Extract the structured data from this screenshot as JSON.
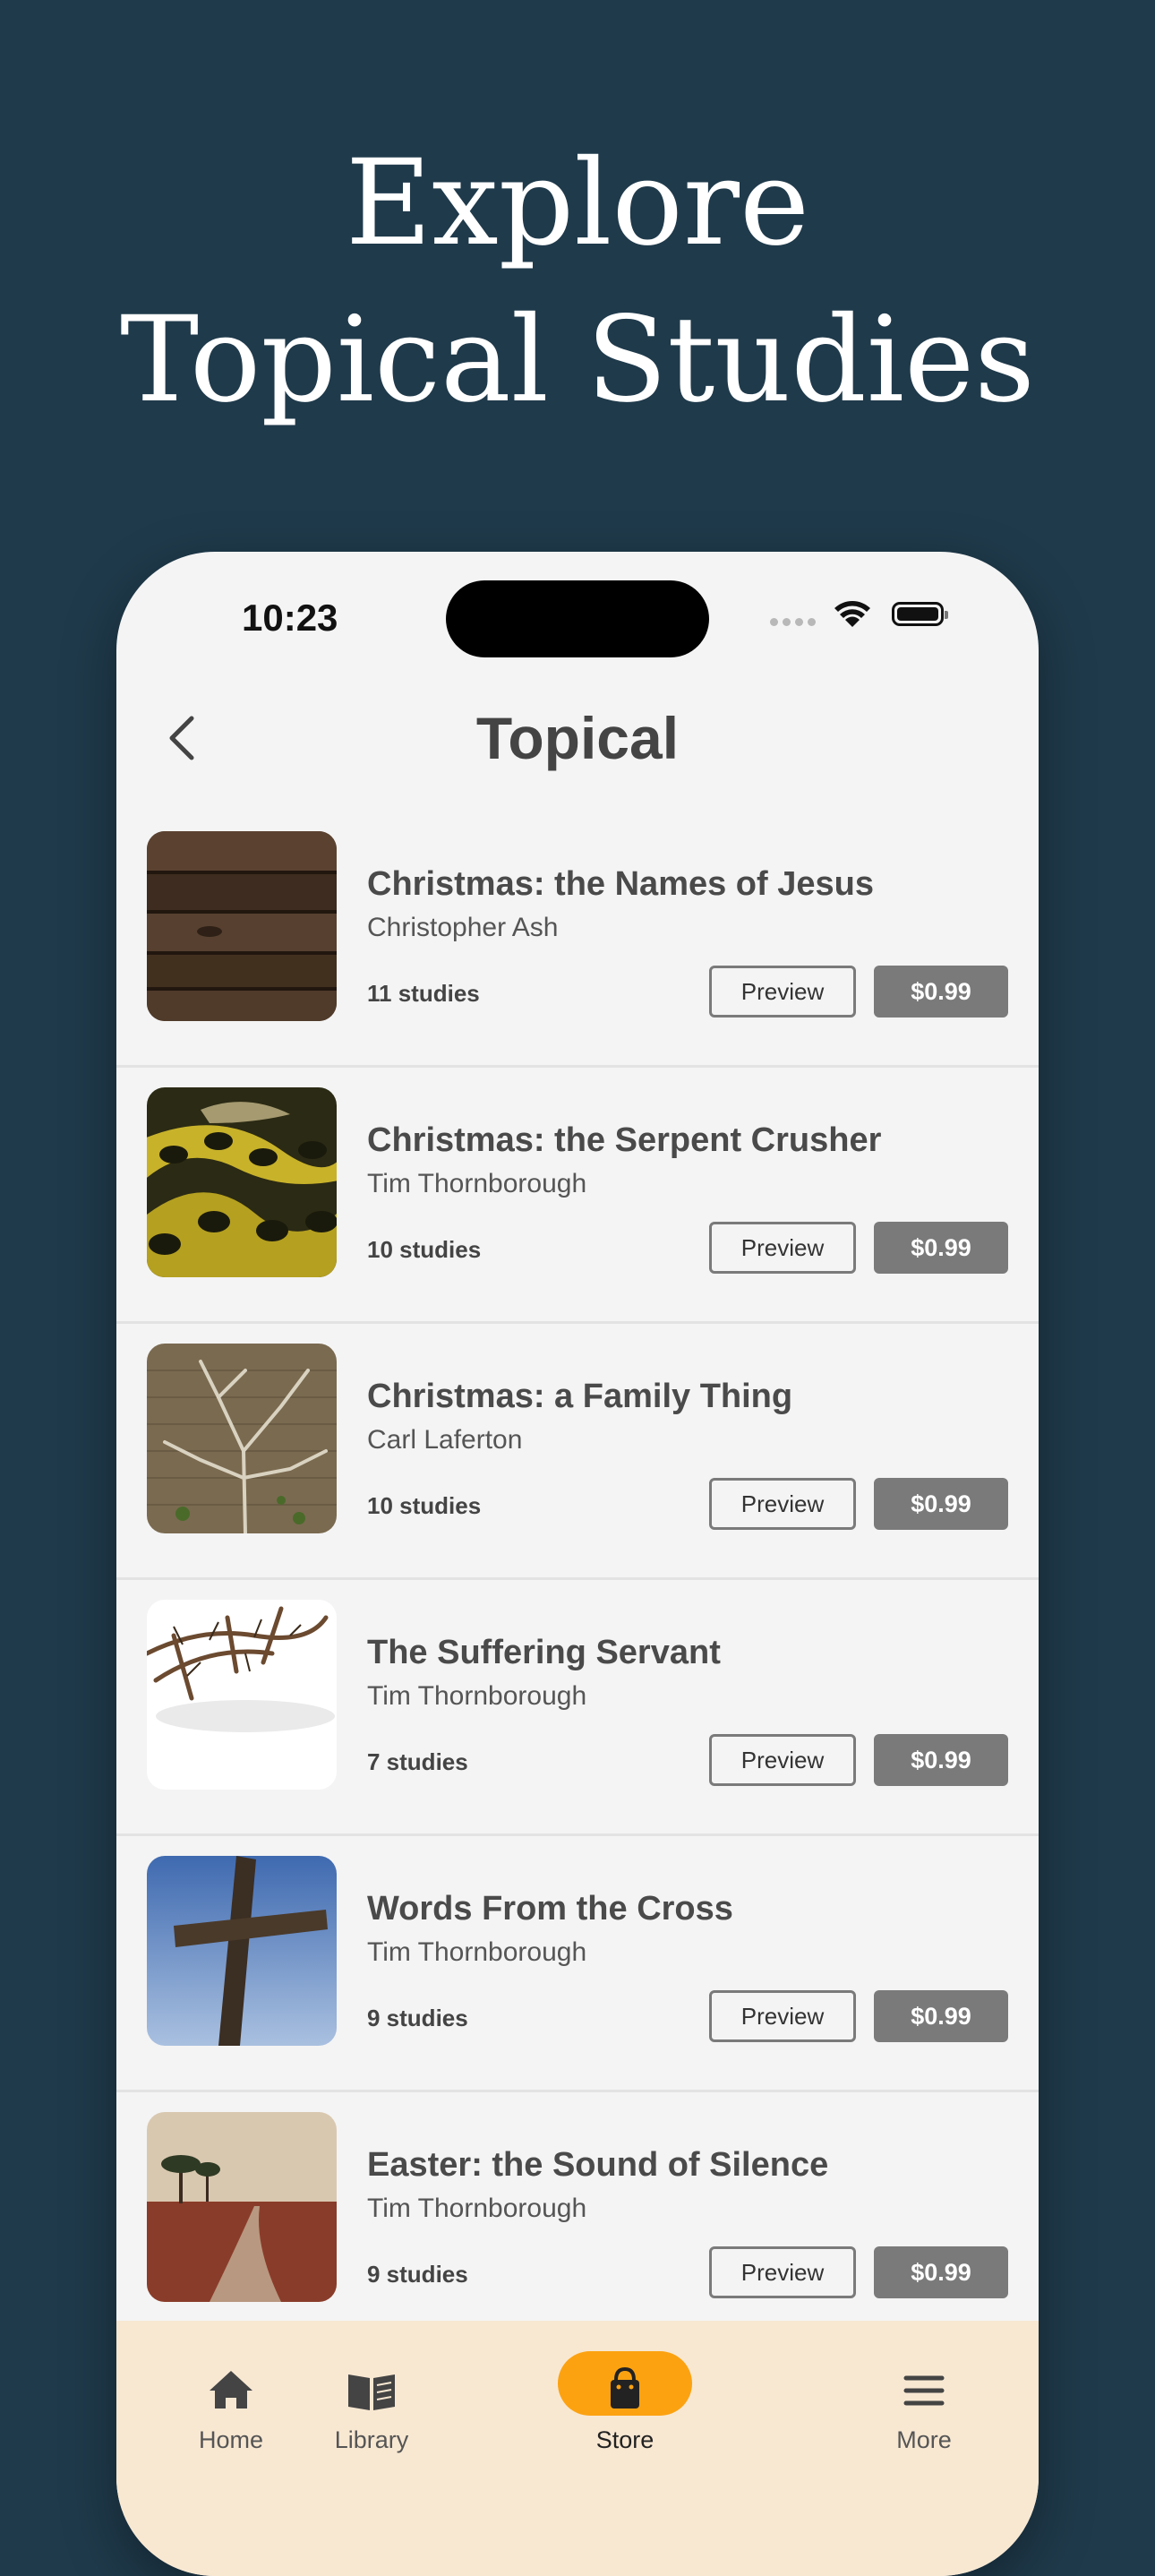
{
  "headline": {
    "line1": "Explore",
    "line2": "Topical Studies"
  },
  "status_bar": {
    "time": "10:23"
  },
  "nav": {
    "title": "Topical"
  },
  "items": [
    {
      "title": "Christmas: the Names of Jesus",
      "author": "Christopher Ash",
      "count": "11 studies",
      "preview": "Preview",
      "price": "$0.99",
      "image": "wooden-planks"
    },
    {
      "title": "Christmas: the Serpent Crusher",
      "author": "Tim Thornborough",
      "count": "10 studies",
      "preview": "Preview",
      "price": "$0.99",
      "image": "snake"
    },
    {
      "title": "Christmas: a Family Thing",
      "author": "Carl Laferton",
      "count": "10 studies",
      "preview": "Preview",
      "price": "$0.99",
      "image": "vine-on-wall"
    },
    {
      "title": "The Suffering Servant",
      "author": "Tim Thornborough",
      "count": "7 studies",
      "preview": "Preview",
      "price": "$0.99",
      "image": "crown-of-thorns"
    },
    {
      "title": "Words From the Cross",
      "author": "Tim Thornborough",
      "count": "9 studies",
      "preview": "Preview",
      "price": "$0.99",
      "image": "wooden-cross"
    },
    {
      "title": "Easter: the Sound of Silence",
      "author": "Tim Thornborough",
      "count": "9 studies",
      "preview": "Preview",
      "price": "$0.99",
      "image": "desert-path"
    }
  ],
  "tabbar": {
    "tabs": [
      {
        "label": "Home",
        "icon": "home-icon"
      },
      {
        "label": "Library",
        "icon": "book-icon"
      },
      {
        "label": "Store",
        "icon": "shopping-bag-icon",
        "active": true
      },
      {
        "label": "More",
        "icon": "menu-icon"
      }
    ]
  },
  "colors": {
    "background": "#1f3a4b",
    "accent": "#fca211",
    "tabbar": "#f8e8d2",
    "price_button": "#7a7a7a"
  }
}
